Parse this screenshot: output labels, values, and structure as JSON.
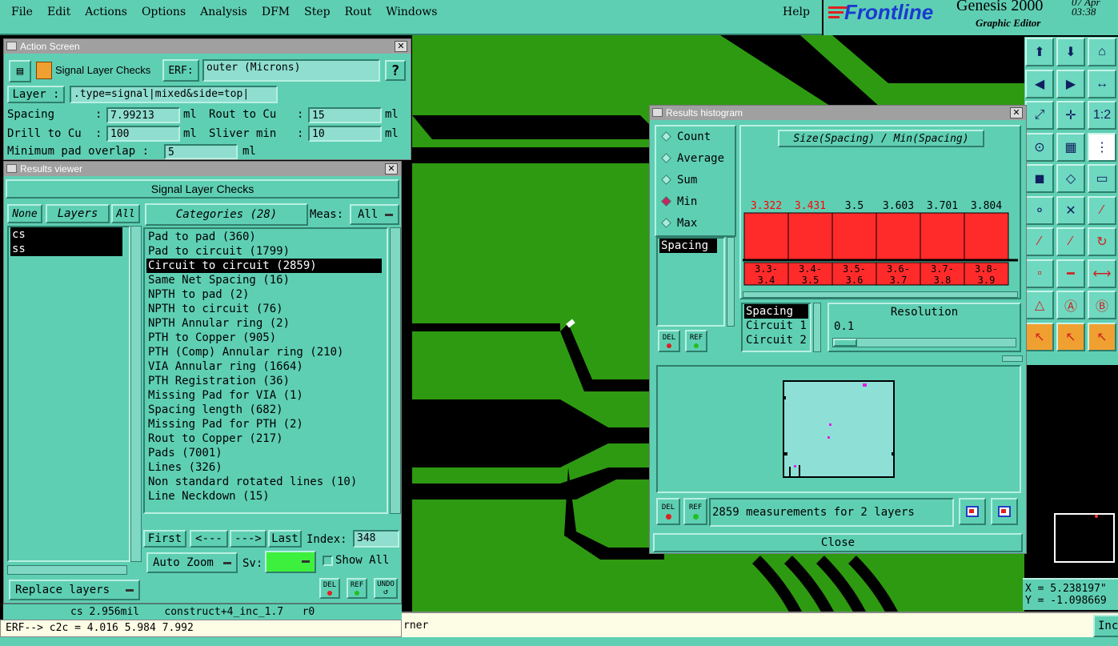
{
  "menu": {
    "items": [
      "File",
      "Edit",
      "Actions",
      "Options",
      "Analysis",
      "DFM",
      "Step",
      "Rout",
      "Windows"
    ],
    "help": "Help"
  },
  "brand": {
    "logo": "Frontline",
    "app": "Genesis 2000",
    "sub": "Graphic Editor",
    "date": "07 Apr",
    "time": "03:38"
  },
  "action_screen": {
    "title": "Action Screen",
    "check_name": "Signal Layer Checks",
    "erf_label": "ERF:",
    "erf_value": "outer (Microns)",
    "help_label": "?",
    "layer_label": "Layer :",
    "layer_value": ".type=signal|mixed&side=top|",
    "spacing_label": "Spacing",
    "spacing_value": "7.99213",
    "unit": "ml",
    "rout_label": "Rout to Cu",
    "rout_value": "15",
    "drill_label": "Drill to Cu",
    "drill_value": "100",
    "sliver_label": "Sliver min",
    "sliver_value": "10",
    "minpad_label": "Minimum pad overlap :",
    "minpad_value": "5",
    "colon": ":"
  },
  "results_viewer": {
    "title": "Results viewer",
    "header": "Signal Layer Checks",
    "none_label": "None",
    "layers_label": "Layers",
    "all_label": "All",
    "layers": [
      "cs",
      "ss"
    ],
    "categories_label": "Categories (28)",
    "meas_label": "Meas:",
    "meas_value": "All",
    "categories": [
      "Pad to pad (360)",
      "Pad to circuit (1799)",
      "Circuit to circuit (2859)",
      "Same Net Spacing (16)",
      "NPTH to pad (2)",
      "NPTH to circuit (76)",
      "NPTH Annular ring (2)",
      "PTH to Copper (905)",
      "PTH (Comp) Annular ring (210)",
      "VIA Annular ring (1664)",
      "PTH Registration (36)",
      "Missing Pad for VIA (1)",
      "Spacing length (682)",
      "Missing Pad for PTH (2)",
      "Rout to Copper (217)",
      "Pads (7001)",
      "Lines (326)",
      "Non standard rotated lines (10)",
      "Line Neckdown (15)"
    ],
    "selected_index": 2,
    "first": "First",
    "prev": "<---",
    "next": "--->",
    "last": "Last",
    "index_label": "Index:",
    "index_value": "348",
    "auto_zoom": "Auto Zoom",
    "sv_label": "Sv:",
    "show_all": "Show All",
    "replace_layers": "Replace layers",
    "del": "DEL",
    "ref": "REF",
    "undo": "UNDO"
  },
  "status": {
    "line1": "cs 2.956mil    construct+4_inc_1.7   r0",
    "line2": "ERF--> c2c = 4.016 5.984 7.992",
    "corner_text": "rner",
    "right_text": "Inc"
  },
  "histogram": {
    "title": "Results histogram",
    "radios": [
      "Count",
      "Average",
      "Sum",
      "Min",
      "Max"
    ],
    "selected_radio": "Min",
    "chart_title": "Size(Spacing) / Min(Spacing)",
    "list_items": [
      "Spacing"
    ],
    "attr_items": [
      "Spacing",
      "Circuit 1",
      "Circuit 2"
    ],
    "resolution_label": "Resolution",
    "resolution_value": "0.1",
    "summary": "2859 measurements for 2 layers",
    "close": "Close",
    "del": "DEL",
    "ref": "REF"
  },
  "chart_data": {
    "type": "bar",
    "title": "Size(Spacing) / Min(Spacing)",
    "categories": [
      "3.3-3.4",
      "3.4-3.5",
      "3.5-3.6",
      "3.6-3.7",
      "3.7-3.8",
      "3.8-3.9"
    ],
    "values": [
      3.322,
      3.431,
      3.5,
      3.603,
      3.701,
      3.804
    ],
    "value_labels": [
      "3.322",
      "3.431",
      "3.5",
      "3.603",
      "3.701",
      "3.804"
    ],
    "category_labels": [
      [
        "3.3-",
        "3.4"
      ],
      [
        "3.4-",
        "3.5"
      ],
      [
        "3.5-",
        "3.6"
      ],
      [
        "3.6-",
        "3.7"
      ],
      [
        "3.7-",
        "3.8"
      ],
      [
        "3.8-",
        "3.9"
      ]
    ],
    "label_colors": [
      "#ff0000",
      "#ff0000",
      "#000000",
      "#000000",
      "#000000",
      "#000000"
    ],
    "bar_color": "#ff2b2b"
  },
  "coords": {
    "x": "X = 5.238197\"",
    "y": "Y = -1.098669"
  },
  "colors": {
    "panel": "#5fcfb4",
    "copper": "#2e9a12",
    "background": "#000000"
  }
}
